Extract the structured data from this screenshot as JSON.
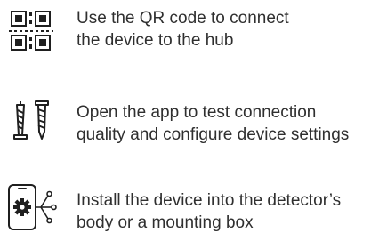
{
  "steps": [
    {
      "icon": "qr-code-icon",
      "line1": "Use the QR code to connect",
      "line2": "the device to the hub"
    },
    {
      "icon": "screws-icon",
      "line1": "Open the app to test connection",
      "line2": "quality and configure device settings"
    },
    {
      "icon": "phone-app-settings-icon",
      "line1": "Install the device into the detector’s",
      "line2": "body or a mounting box"
    }
  ]
}
